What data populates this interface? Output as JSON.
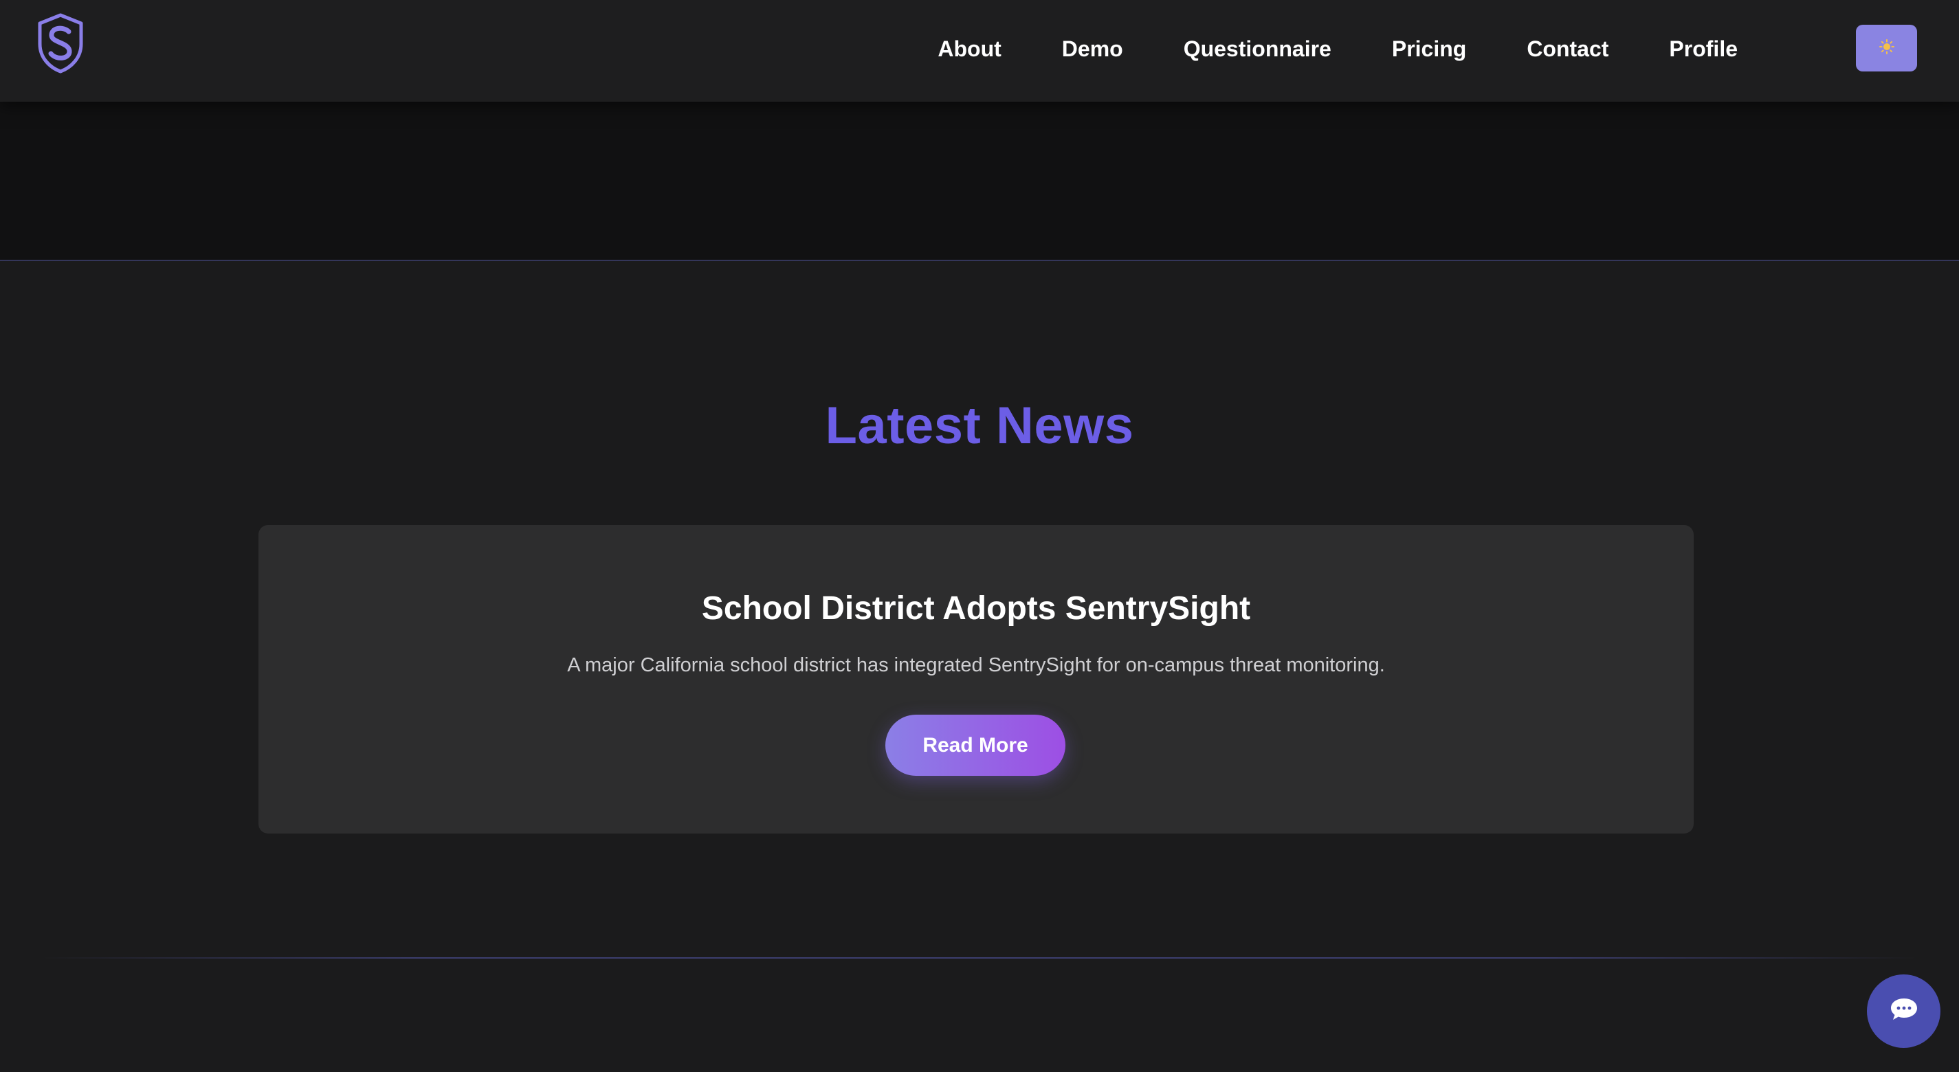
{
  "nav": {
    "logo_icon": "shield-s-logo-icon",
    "links": [
      "About",
      "Demo",
      "Questionnaire",
      "Pricing",
      "Contact",
      "Profile"
    ],
    "theme_toggle_icon": "sun-icon"
  },
  "news": {
    "title": "Latest News",
    "cards": [
      {
        "title": "School District Adopts SentrySight",
        "description": "A major California school district has integrated SentrySight for on-campus threat monitoring.",
        "button": "Read More"
      }
    ]
  },
  "chat": {
    "icon": "chat-bubble-icon"
  },
  "colors": {
    "accent": "#6c5ee6",
    "button_gradient_start": "#8b7fe6",
    "button_gradient_end": "#9d4fe4",
    "chat_button": "#4a4eb0",
    "background": "#1b1b1c"
  }
}
